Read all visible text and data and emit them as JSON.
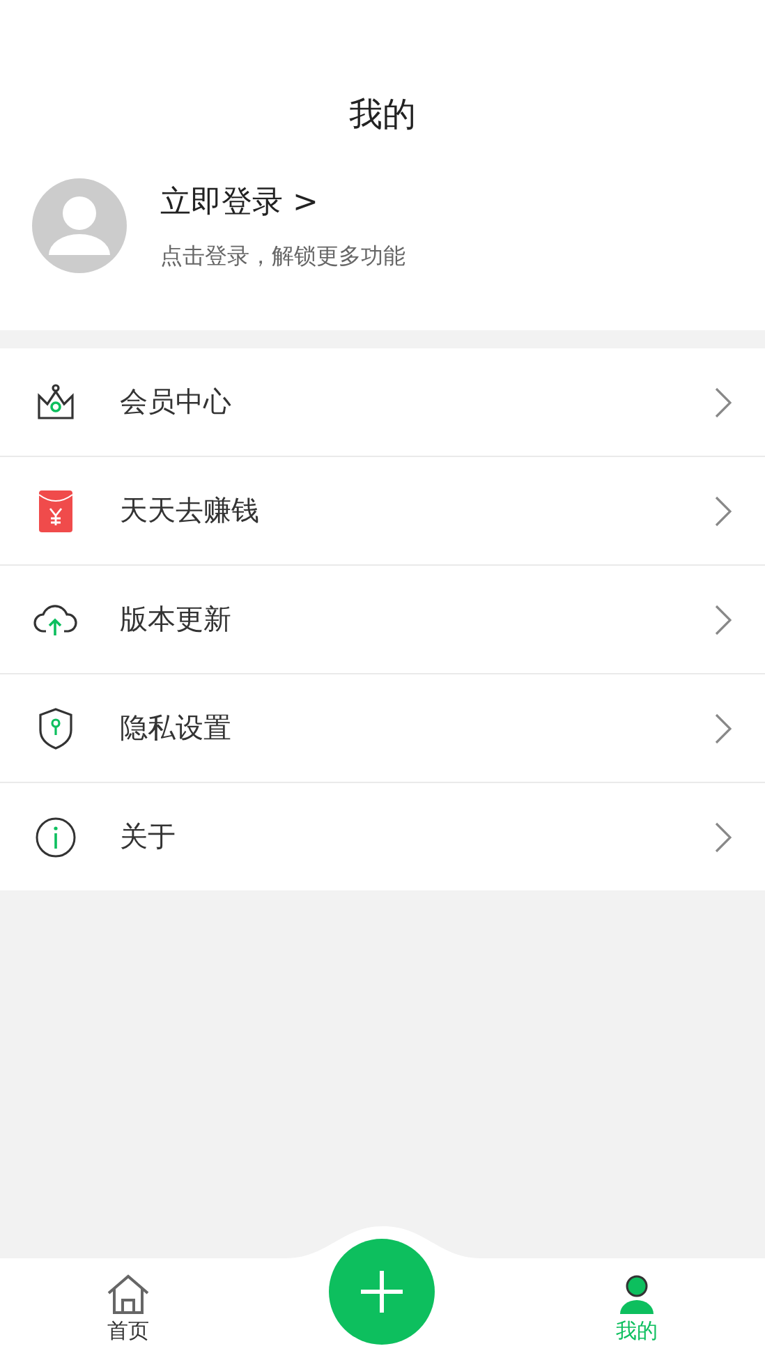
{
  "header": {
    "title": "我的"
  },
  "profile": {
    "name": "立即登录 >",
    "hint": "点击登录，解锁更多功能"
  },
  "menu": [
    {
      "kind": "crown",
      "label": "会员中心"
    },
    {
      "kind": "envelope",
      "label": "天天去赚钱"
    },
    {
      "kind": "cloud",
      "label": "版本更新"
    },
    {
      "kind": "shield",
      "label": "隐私设置"
    },
    {
      "kind": "info",
      "label": "关于"
    }
  ],
  "tabbar": {
    "tabs": [
      {
        "kind": "home",
        "label": "首页",
        "selected": false
      },
      {
        "kind": "add"
      },
      {
        "kind": "person",
        "label": "我的",
        "selected": true
      }
    ]
  }
}
